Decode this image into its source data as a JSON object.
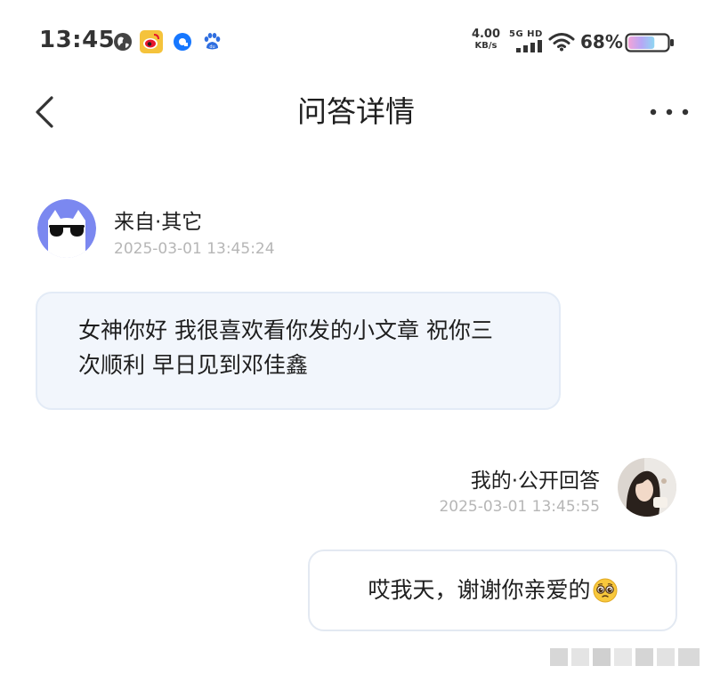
{
  "status_bar": {
    "time": "13:45",
    "notification_icons": [
      "globe-icon",
      "weibo-icon",
      "blue-app-icon",
      "baidu-paw-icon"
    ],
    "net_speed_value": "4.00",
    "net_speed_unit": "KB/s",
    "network_type": "5G HD",
    "battery_percent": "68%",
    "battery_level": 0.68
  },
  "nav": {
    "title": "问答详情"
  },
  "question": {
    "source_label": "来自·其它",
    "timestamp": "2025-03-01 13:45:24",
    "text": "女神你好 我很喜欢看你发的小文章 祝你三次顺利 早日见到邓佳鑫"
  },
  "answer": {
    "label": "我的·公开回答",
    "timestamp": "2025-03-01 13:45:55",
    "text": "哎我天，谢谢你亲爱的",
    "emoji": "pleading-face-icon"
  },
  "colors": {
    "avatar_bg": "#7b88f0",
    "question_bubble_bg": "#f2f6fc",
    "timestamp_gray": "#b6b6b6"
  }
}
